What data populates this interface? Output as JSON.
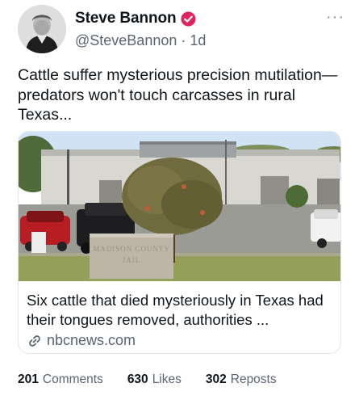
{
  "author": {
    "display_name": "Steve Bannon",
    "handle": "@SteveBannon",
    "separator": "·",
    "time": "1d",
    "avatar_icon": "profile-photo",
    "verified_icon": "verified-badge-icon",
    "verified_color": "#e0245e"
  },
  "post": {
    "text": "Cattle suffer mysterious precision mutilation—predators won't touch carcasses in rural Texas..."
  },
  "card": {
    "sign_text": "MADISON COUNTY JAIL",
    "title": "Six cattle that died mysteriously in Texas had their tongues removed, authorities ...",
    "domain": "nbcnews.com",
    "link_icon": "link-icon"
  },
  "stats": [
    {
      "count": "201",
      "label": "Comments"
    },
    {
      "count": "630",
      "label": "Likes"
    },
    {
      "count": "302",
      "label": "Reposts"
    }
  ],
  "more_icon": "more-options-icon"
}
